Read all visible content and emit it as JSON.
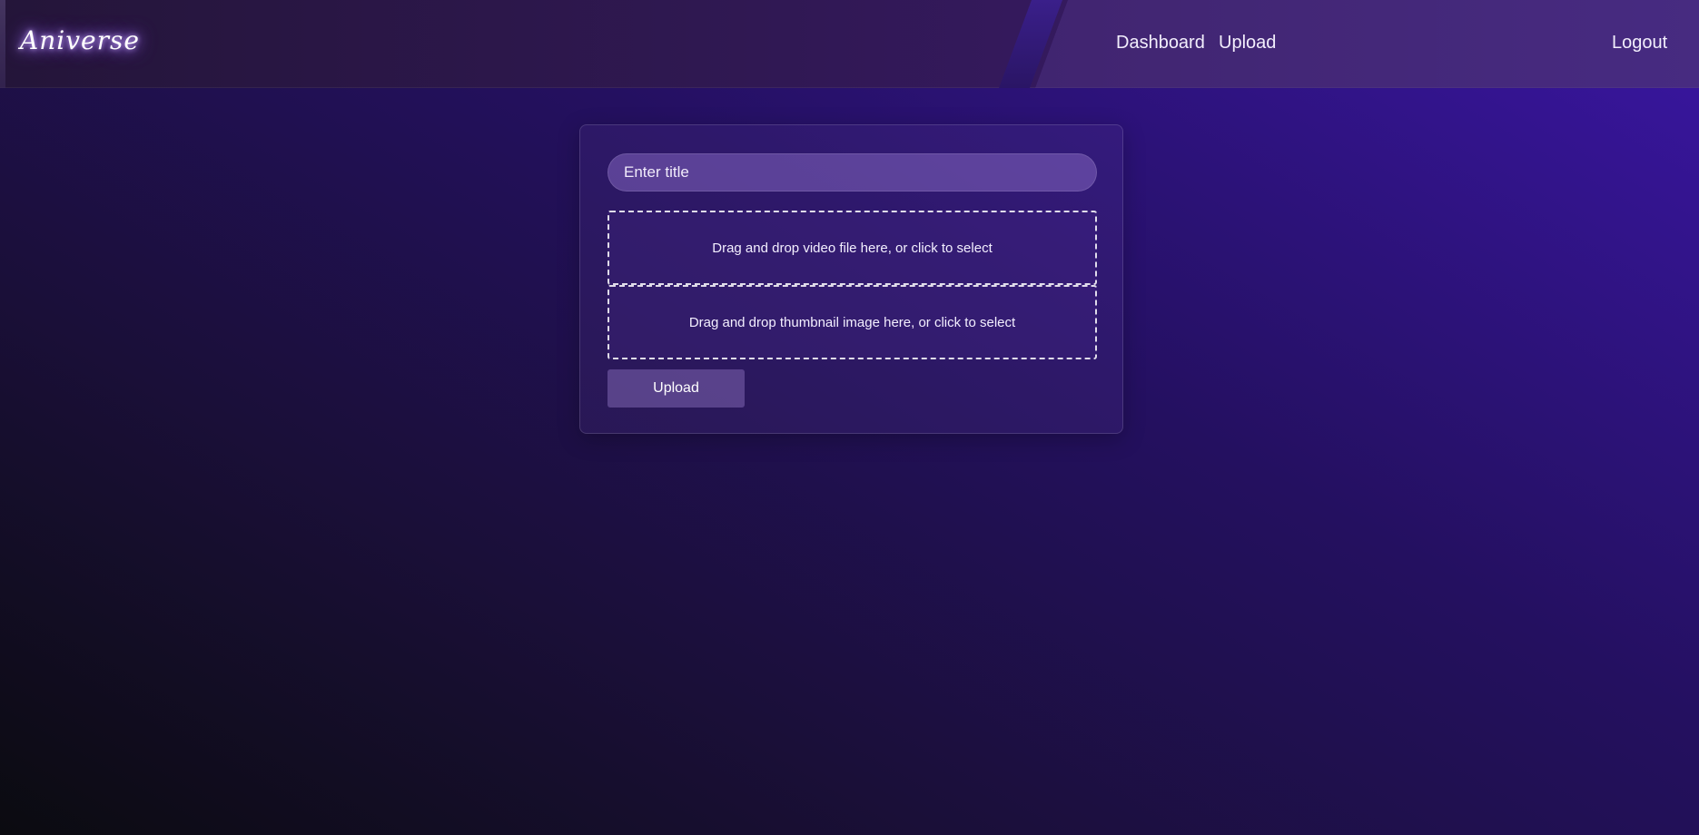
{
  "navbar": {
    "logo": "Aniverse",
    "links": {
      "dashboard": "Dashboard",
      "upload": "Upload",
      "logout": "Logout"
    }
  },
  "form": {
    "title_placeholder": "Enter title",
    "title_value": "",
    "video_dropzone": "Drag and drop video file here, or click to select",
    "thumbnail_dropzone": "Drag and drop thumbnail image here, or click to select",
    "submit_label": "Upload"
  }
}
